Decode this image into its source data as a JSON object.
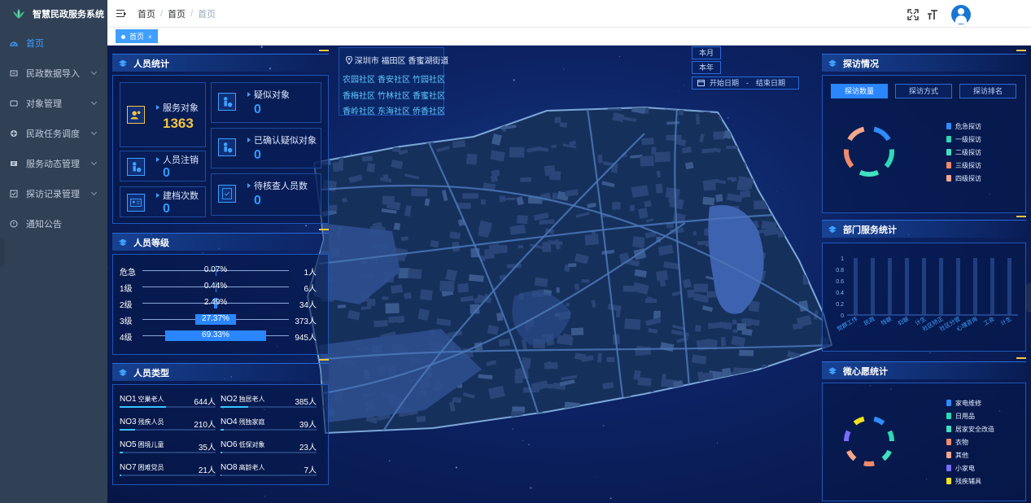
{
  "app": {
    "title": "智慧民政服务系统"
  },
  "sidebar": {
    "items": [
      {
        "label": "首页",
        "icon": "dashboard-icon",
        "active": true
      },
      {
        "label": "民政数据导入",
        "icon": "import-icon"
      },
      {
        "label": "对象管理",
        "icon": "object-icon"
      },
      {
        "label": "民政任务调度",
        "icon": "dispatch-icon"
      },
      {
        "label": "服务动态管理",
        "icon": "service-icon"
      },
      {
        "label": "探访记录管理",
        "icon": "record-icon"
      },
      {
        "label": "通知公告",
        "icon": "notice-icon"
      }
    ]
  },
  "header": {
    "breadcrumb": [
      "首页",
      "首页",
      "首页"
    ],
    "tag": {
      "label": "首页"
    }
  },
  "person_stats": {
    "title": "人员统计",
    "service": {
      "label": "服务对象",
      "value": "1363"
    },
    "cancel": {
      "label": "人员注销",
      "value": "0"
    },
    "archive": {
      "label": "建档次数",
      "value": "0"
    },
    "suspect": {
      "label": "疑似对象",
      "value": "0"
    },
    "confirmed": {
      "label": "已确认疑似对象",
      "value": "0"
    },
    "pending": {
      "label": "待核查人员数",
      "value": "0"
    }
  },
  "person_level": {
    "title": "人员等级",
    "rows": [
      {
        "name": "危急",
        "pct": "0.07%",
        "count": "1人",
        "fill": 0.0007
      },
      {
        "name": "1级",
        "pct": "0.44%",
        "count": "6人",
        "fill": 0.0044
      },
      {
        "name": "2级",
        "pct": "2.49%",
        "count": "34人",
        "fill": 0.0249
      },
      {
        "name": "3级",
        "pct": "27.37%",
        "count": "373人",
        "fill": 0.2737
      },
      {
        "name": "4级",
        "pct": "69.33%",
        "count": "945人",
        "fill": 0.6933
      }
    ]
  },
  "person_type": {
    "title": "人员类型",
    "items": [
      {
        "no": "NO1",
        "type": "空巢老人",
        "count": "644人",
        "fill": 0.48
      },
      {
        "no": "NO2",
        "type": "独居老人",
        "count": "385人",
        "fill": 0.29
      },
      {
        "no": "NO3",
        "type": "残疾人员",
        "count": "210人",
        "fill": 0.16
      },
      {
        "no": "NO4",
        "type": "残独家庭",
        "count": "39人",
        "fill": 0.03
      },
      {
        "no": "NO5",
        "type": "困境儿童",
        "count": "35人",
        "fill": 0.03
      },
      {
        "no": "NO6",
        "type": "低保对象",
        "count": "23人",
        "fill": 0.02
      },
      {
        "no": "NO7",
        "type": "困难党员",
        "count": "21人",
        "fill": 0.02
      },
      {
        "no": "NO8",
        "type": "高龄老人",
        "count": "7人",
        "fill": 0.01
      }
    ]
  },
  "location": {
    "address": "深圳市 福田区 香蜜湖街道",
    "communities": [
      "农园社区",
      "香安社区",
      "竹园社区",
      "香梅社区",
      "竹林社区",
      "香蜜社区",
      "香岭社区",
      "东海社区",
      "侨香社区"
    ]
  },
  "date_filter": {
    "month": "本月",
    "year": "本年",
    "start_placeholder": "开始日期",
    "dash": "-",
    "end_placeholder": "结束日期"
  },
  "visit": {
    "title": "探访情况",
    "tabs": [
      "探访数量",
      "探访方式",
      "探访排名"
    ],
    "legend": [
      {
        "name": "危急探访",
        "color": "#2f8cff"
      },
      {
        "name": "一级探访",
        "color": "#2ed8b6"
      },
      {
        "name": "二级探访",
        "color": "#41e0c0"
      },
      {
        "name": "三级探访",
        "color": "#f08a6a"
      },
      {
        "name": "四级探访",
        "color": "#f4a78a"
      }
    ]
  },
  "dept": {
    "title": "部门服务统计",
    "yticks": [
      "1",
      "0.8",
      "0.6",
      "0.4",
      "0.2",
      "0"
    ],
    "categories": [
      "党群工作",
      "民政",
      "残联",
      "妇联",
      "计生",
      "社区矫正",
      "社区分管",
      "心理咨询",
      "工会",
      "计生"
    ]
  },
  "wish": {
    "title": "微心愿统计",
    "legend": [
      {
        "name": "家电维修",
        "color": "#2f8cff"
      },
      {
        "name": "日用品",
        "color": "#2ed8b6"
      },
      {
        "name": "居家安全改造",
        "color": "#41e0c0"
      },
      {
        "name": "衣物",
        "color": "#f08a6a"
      },
      {
        "name": "其他",
        "color": "#f4a78a"
      },
      {
        "name": "小家电",
        "color": "#7a6cff"
      },
      {
        "name": "残疾辅具",
        "color": "#f2e21b"
      }
    ]
  }
}
